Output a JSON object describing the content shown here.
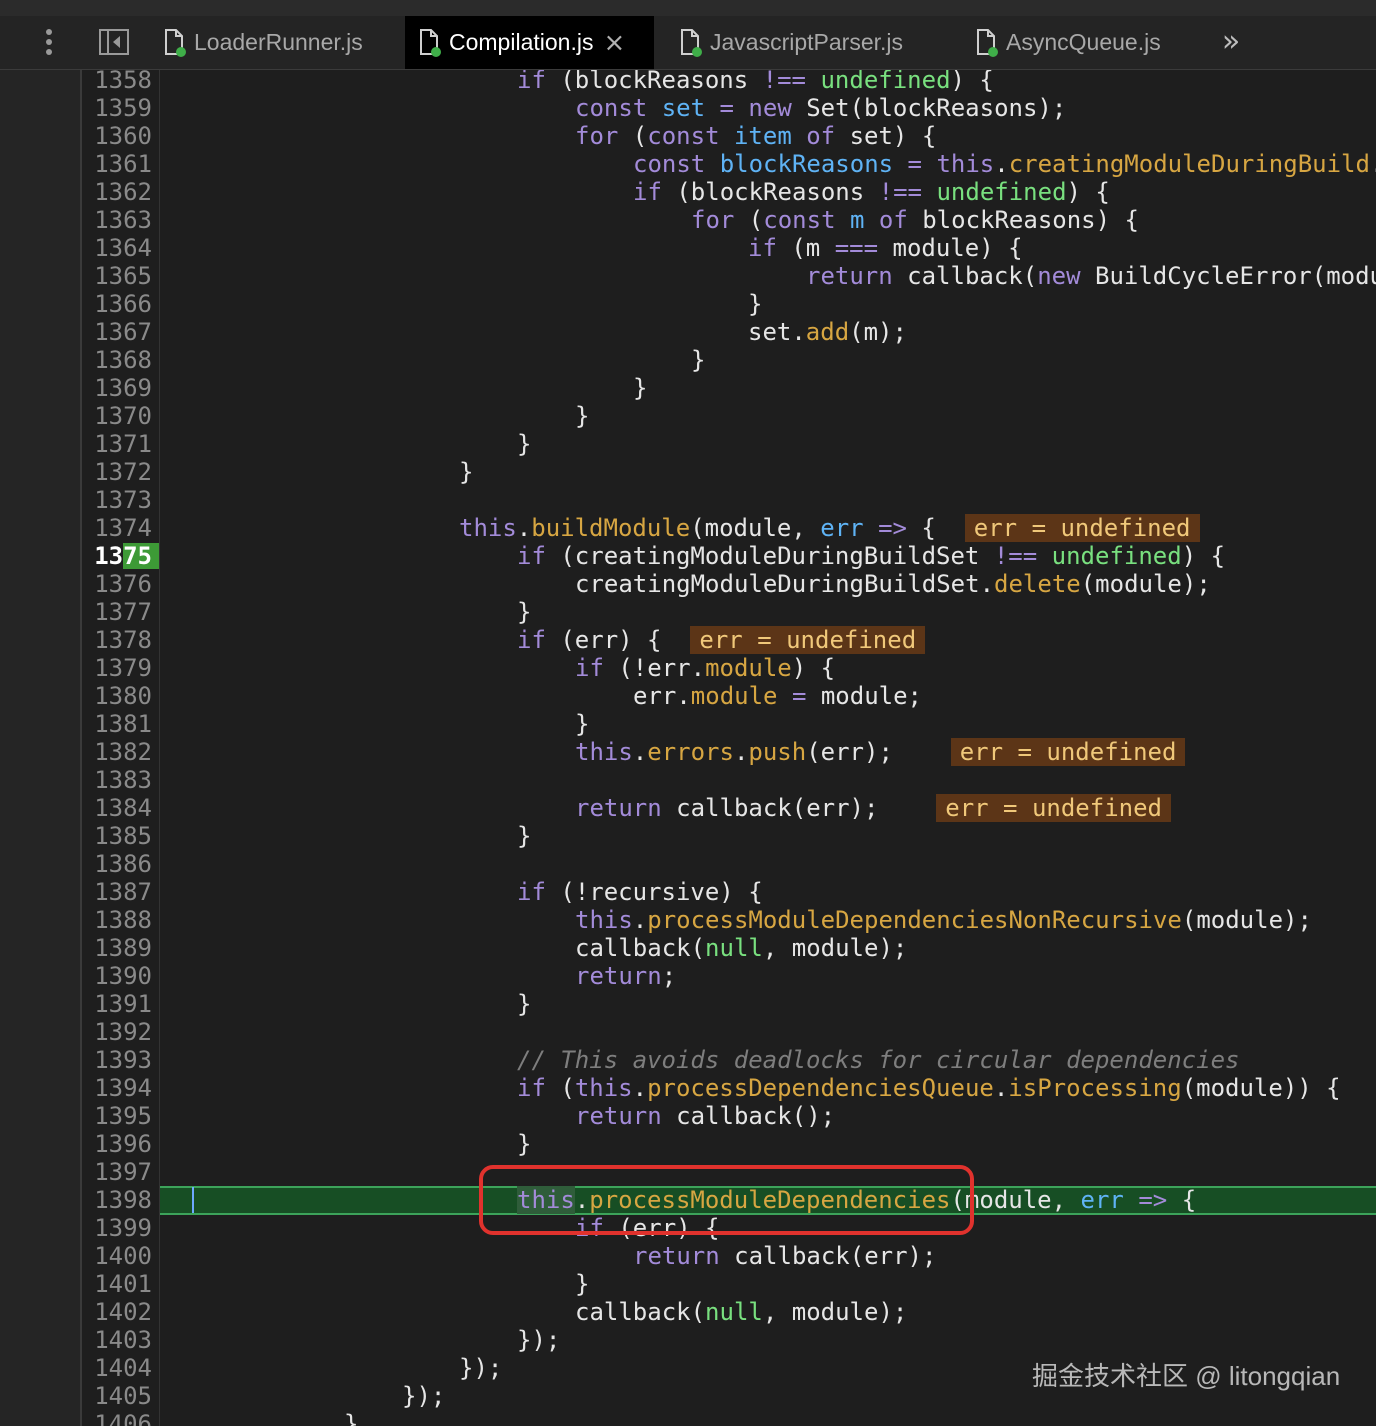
{
  "editor": {
    "tabs": [
      {
        "label": "LoaderRunner.js",
        "icon": "js-file-icon",
        "active": false
      },
      {
        "label": "Compilation.js",
        "icon": "js-file-icon",
        "active": true,
        "close": "×"
      },
      {
        "label": "JavascriptParser.js",
        "icon": "js-file-icon",
        "active": false
      },
      {
        "label": "AsyncQueue.js",
        "icon": "js-file-icon",
        "active": false
      }
    ],
    "overflow_label": "»",
    "breakpoint_line": "1375",
    "paused_line": "1398",
    "colors": {
      "keyword": "#a38bd9",
      "function": "#d7a642",
      "literal": "#79e07f",
      "property": "#5fb3f5",
      "comment": "#7e7e7e",
      "inline_value_bg": "#5c3517",
      "paused_line_bg": "#174e24",
      "breakpoint": "#3d9a36",
      "annotation_box": "#e0322d"
    }
  },
  "line_numbers": [
    "1358",
    "1359",
    "1360",
    "1361",
    "1362",
    "1363",
    "1364",
    "1365",
    "1366",
    "1367",
    "1368",
    "1369",
    "1370",
    "1371",
    "1372",
    "1373",
    "1374",
    "1375",
    "1376",
    "1377",
    "1378",
    "1379",
    "1380",
    "1381",
    "1382",
    "1383",
    "1384",
    "1385",
    "1386",
    "1387",
    "1388",
    "1389",
    "1390",
    "1391",
    "1392",
    "1393",
    "1394",
    "1395",
    "1396",
    "1397",
    "1398",
    "1399",
    "1400",
    "1401",
    "1402",
    "1403",
    "1404",
    "1405",
    "1406"
  ],
  "code_lines": [
    [
      [
        "kw",
        "if"
      ],
      [
        "t",
        " (blockReasons "
      ],
      [
        "kw",
        "!=="
      ],
      [
        "t",
        " "
      ],
      [
        "lit",
        "undefined"
      ],
      [
        "t",
        ") {"
      ]
    ],
    [
      [
        "kw",
        "const"
      ],
      [
        "t",
        " "
      ],
      [
        "prop",
        "set"
      ],
      [
        "t",
        " "
      ],
      [
        "kw",
        "="
      ],
      [
        "t",
        " "
      ],
      [
        "kw",
        "new"
      ],
      [
        "t",
        " Set(blockReasons);"
      ]
    ],
    [
      [
        "kw",
        "for"
      ],
      [
        "t",
        " ("
      ],
      [
        "kw",
        "const"
      ],
      [
        "t",
        " "
      ],
      [
        "prop",
        "item"
      ],
      [
        "t",
        " "
      ],
      [
        "kw",
        "of"
      ],
      [
        "t",
        " set) {"
      ]
    ],
    [
      [
        "kw",
        "const"
      ],
      [
        "t",
        " "
      ],
      [
        "prop",
        "blockReasons"
      ],
      [
        "t",
        " "
      ],
      [
        "kw",
        "="
      ],
      [
        "t",
        " "
      ],
      [
        "kw",
        "this"
      ],
      [
        "t",
        "."
      ],
      [
        "fn",
        "creatingModuleDuringBuild"
      ],
      [
        "t",
        "."
      ]
    ],
    [
      [
        "kw",
        "if"
      ],
      [
        "t",
        " (blockReasons "
      ],
      [
        "kw",
        "!=="
      ],
      [
        "t",
        " "
      ],
      [
        "lit",
        "undefined"
      ],
      [
        "t",
        ") {"
      ]
    ],
    [
      [
        "kw",
        "for"
      ],
      [
        "t",
        " ("
      ],
      [
        "kw",
        "const"
      ],
      [
        "t",
        " "
      ],
      [
        "prop",
        "m"
      ],
      [
        "t",
        " "
      ],
      [
        "kw",
        "of"
      ],
      [
        "t",
        " blockReasons) {"
      ]
    ],
    [
      [
        "kw",
        "if"
      ],
      [
        "t",
        " (m "
      ],
      [
        "kw",
        "==="
      ],
      [
        "t",
        " module) {"
      ]
    ],
    [
      [
        "kw",
        "return"
      ],
      [
        "t",
        " callback("
      ],
      [
        "kw",
        "new"
      ],
      [
        "t",
        " BuildCycleError(modu"
      ]
    ],
    [
      [
        "t",
        "}"
      ]
    ],
    [
      [
        "t",
        "set."
      ],
      [
        "fn",
        "add"
      ],
      [
        "t",
        "(m);"
      ]
    ],
    [
      [
        "t",
        "}"
      ]
    ],
    [
      [
        "t",
        "}"
      ]
    ],
    [
      [
        "t",
        "}"
      ]
    ],
    [
      [
        "t",
        "}"
      ]
    ],
    [
      [
        "t",
        "}"
      ]
    ],
    [],
    [
      [
        "kw",
        "this"
      ],
      [
        "t",
        "."
      ],
      [
        "fn",
        "buildModule"
      ],
      [
        "t",
        "(module, "
      ],
      [
        "prop",
        "err"
      ],
      [
        "t",
        " "
      ],
      [
        "kw",
        "=>"
      ],
      [
        "t",
        " {  "
      ],
      [
        "inl",
        "err = undefined"
      ]
    ],
    [
      [
        "kw",
        "if"
      ],
      [
        "t",
        " (creatingModuleDuringBuildSet "
      ],
      [
        "kw",
        "!=="
      ],
      [
        "t",
        " "
      ],
      [
        "lit",
        "undefined"
      ],
      [
        "t",
        ") {"
      ]
    ],
    [
      [
        "t",
        "creatingModuleDuringBuildSet."
      ],
      [
        "fn",
        "delete"
      ],
      [
        "t",
        "(module);"
      ]
    ],
    [
      [
        "t",
        "}"
      ]
    ],
    [
      [
        "kw",
        "if"
      ],
      [
        "t",
        " (err) {  "
      ],
      [
        "inl",
        "err = undefined"
      ]
    ],
    [
      [
        "kw",
        "if"
      ],
      [
        "t",
        " (!err."
      ],
      [
        "fn",
        "module"
      ],
      [
        "t",
        ") {"
      ]
    ],
    [
      [
        "t",
        "err."
      ],
      [
        "fn",
        "module"
      ],
      [
        "t",
        " "
      ],
      [
        "kw",
        "="
      ],
      [
        "t",
        " module;"
      ]
    ],
    [
      [
        "t",
        "}"
      ]
    ],
    [
      [
        "kw",
        "this"
      ],
      [
        "t",
        "."
      ],
      [
        "fn",
        "errors"
      ],
      [
        "t",
        "."
      ],
      [
        "fn",
        "push"
      ],
      [
        "t",
        "(err);    "
      ],
      [
        "inl",
        "err = undefined"
      ]
    ],
    [],
    [
      [
        "kw",
        "return"
      ],
      [
        "t",
        " callback(err);    "
      ],
      [
        "inl",
        "err = undefined"
      ]
    ],
    [
      [
        "t",
        "}"
      ]
    ],
    [],
    [
      [
        "kw",
        "if"
      ],
      [
        "t",
        " (!recursive) {"
      ]
    ],
    [
      [
        "kw",
        "this"
      ],
      [
        "t",
        "."
      ],
      [
        "fn",
        "processModuleDependenciesNonRecursive"
      ],
      [
        "t",
        "(module);"
      ]
    ],
    [
      [
        "t",
        "callback("
      ],
      [
        "lit",
        "null"
      ],
      [
        "t",
        ", module);"
      ]
    ],
    [
      [
        "kw",
        "return"
      ],
      [
        "t",
        ";"
      ]
    ],
    [
      [
        "t",
        "}"
      ]
    ],
    [],
    [
      [
        "cm",
        "// This avoids deadlocks for circular dependencies"
      ]
    ],
    [
      [
        "kw",
        "if"
      ],
      [
        "t",
        " ("
      ],
      [
        "kw",
        "this"
      ],
      [
        "t",
        "."
      ],
      [
        "fn",
        "processDependenciesQueue"
      ],
      [
        "t",
        "."
      ],
      [
        "fn",
        "isProcessing"
      ],
      [
        "t",
        "(module)) {"
      ]
    ],
    [
      [
        "kw",
        "return"
      ],
      [
        "t",
        " callback();"
      ]
    ],
    [
      [
        "t",
        "}"
      ]
    ],
    [],
    [
      [
        "kw",
        "this"
      ],
      [
        "t",
        "."
      ],
      [
        "fn",
        "processModuleDependencies"
      ],
      [
        "t",
        "(module, "
      ],
      [
        "prop",
        "err"
      ],
      [
        "t",
        " "
      ],
      [
        "kw",
        "=>"
      ],
      [
        "t",
        " {"
      ]
    ],
    [
      [
        "kw",
        "if"
      ],
      [
        "t",
        " (err) {"
      ]
    ],
    [
      [
        "kw",
        "return"
      ],
      [
        "t",
        " callback(err);"
      ]
    ],
    [
      [
        "t",
        "}"
      ]
    ],
    [
      [
        "t",
        "callback("
      ],
      [
        "lit",
        "null"
      ],
      [
        "t",
        ", module);"
      ]
    ],
    [
      [
        "t",
        "});"
      ]
    ],
    [
      [
        "t",
        "});"
      ]
    ],
    [
      [
        "t",
        "});"
      ]
    ],
    [
      [
        "t",
        "}"
      ]
    ]
  ],
  "watermark": "掘金技术社区 @ litongqian"
}
